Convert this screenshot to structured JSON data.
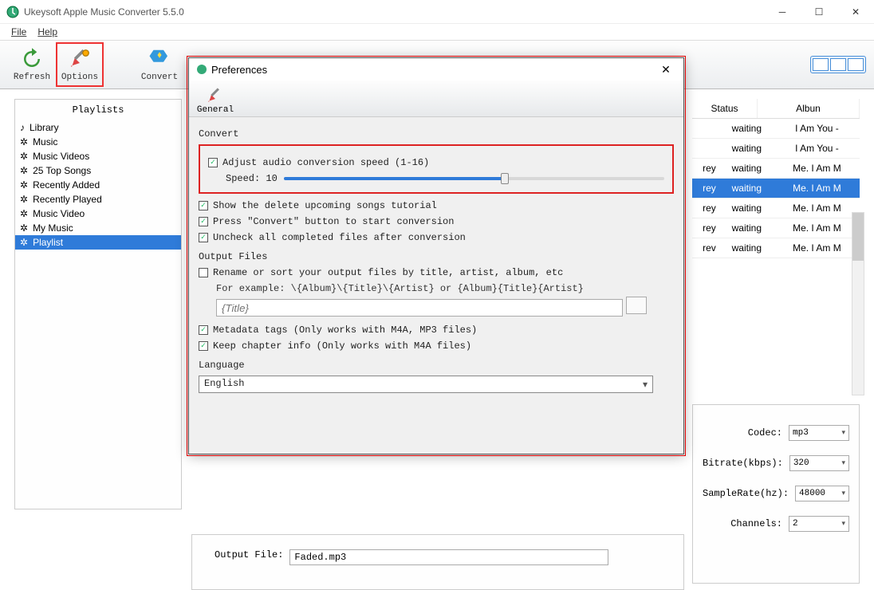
{
  "window": {
    "title": "Ukeysoft Apple Music Converter 5.5.0"
  },
  "menu": {
    "file": "File",
    "help": "Help"
  },
  "toolbar": {
    "refresh": "Refresh",
    "options": "Options",
    "convert": "Convert"
  },
  "sidebar": {
    "heading": "Playlists",
    "items": [
      {
        "label": "Library",
        "icon": "note"
      },
      {
        "label": "Music",
        "icon": "gear"
      },
      {
        "label": "Music Videos",
        "icon": "gear"
      },
      {
        "label": "25 Top Songs",
        "icon": "gear"
      },
      {
        "label": "Recently Added",
        "icon": "gear"
      },
      {
        "label": "Recently Played",
        "icon": "gear"
      },
      {
        "label": "Music Video",
        "icon": "gear"
      },
      {
        "label": "My Music",
        "icon": "gear"
      },
      {
        "label": "Playlist",
        "icon": "gear",
        "selected": true
      }
    ]
  },
  "table": {
    "headers": {
      "status": "Status",
      "album": "Albun"
    },
    "rows": [
      {
        "artist": "",
        "status": "waiting",
        "album": "I Am You -"
      },
      {
        "artist": "",
        "status": "waiting",
        "album": "I Am You -"
      },
      {
        "artist": "rey",
        "status": "waiting",
        "album": "Me. I Am M"
      },
      {
        "artist": "rey",
        "status": "waiting",
        "album": "Me. I Am M",
        "selected": true
      },
      {
        "artist": "rey",
        "status": "waiting",
        "album": "Me. I Am M"
      },
      {
        "artist": "rey",
        "status": "waiting",
        "album": "Me. I Am M"
      },
      {
        "artist": "rev",
        "status": "waiting",
        "album": "Me. I Am M"
      }
    ]
  },
  "output": {
    "codec_label": "Codec:",
    "codec": "mp3",
    "bitrate_label": "Bitrate(kbps):",
    "bitrate": "320",
    "samplerate_label": "SampleRate(hz):",
    "samplerate": "48000",
    "channels_label": "Channels:",
    "channels": "2",
    "file_label": "Output File:",
    "file": "Faded.mp3"
  },
  "prefs": {
    "title": "Preferences",
    "tab": "General",
    "convert_label": "Convert",
    "adjust": "Adjust audio conversion speed (1-16)",
    "speed_label": "Speed: 10",
    "show_delete": "Show the delete upcoming songs tutorial",
    "press_convert": "Press \"Convert\" button to start conversion",
    "uncheck_all": "Uncheck all completed files after conversion",
    "output_label": "Output Files",
    "rename": "Rename or sort your output files by title, artist, album, etc",
    "example": "For example: \\{Album}\\{Title}\\{Artist} or {Album}{Title}{Artist}",
    "pattern_placeholder": "{Title}",
    "metadata": "Metadata tags (Only works with M4A, MP3 files)",
    "chapter": "Keep chapter info (Only works with M4A files)",
    "language_label": "Language",
    "language": "English"
  }
}
